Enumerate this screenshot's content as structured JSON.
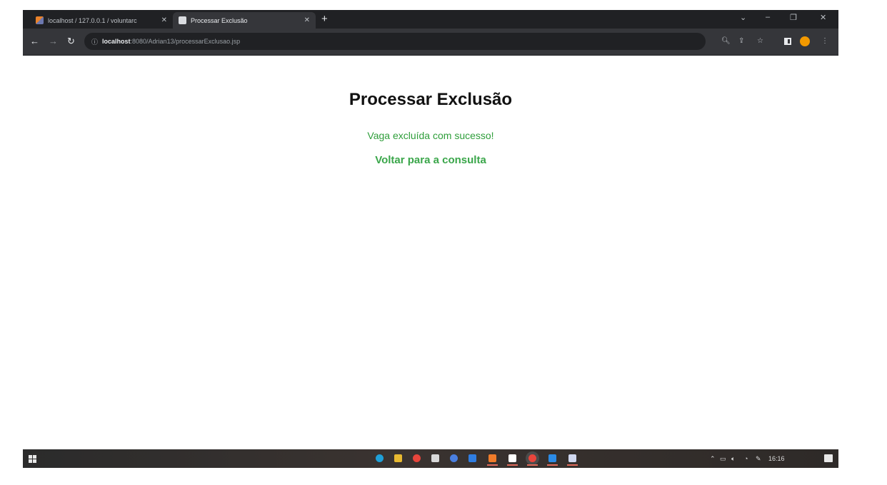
{
  "browser": {
    "tabs": [
      {
        "title": "localhost / 127.0.0.1 / voluntarc",
        "favicon": "phpmyadmin-icon",
        "active": false
      },
      {
        "title": "Processar Exclusão",
        "favicon": "document-icon",
        "active": true
      }
    ],
    "address": {
      "host": "localhost",
      "path": ":8080/Adrian13/processarExclusao.jsp"
    }
  },
  "page": {
    "heading": "Processar Exclusão",
    "message": "Vaga excluída com sucesso!",
    "back_link": "Voltar para a consulta"
  },
  "taskbar": {
    "clock": "16:16"
  },
  "colors": {
    "success_text": "#2e9e3a",
    "link_text": "#3aa64a",
    "chrome_dark": "#202124",
    "chrome_toolbar": "#35363a",
    "profile_avatar": "#f29900"
  }
}
